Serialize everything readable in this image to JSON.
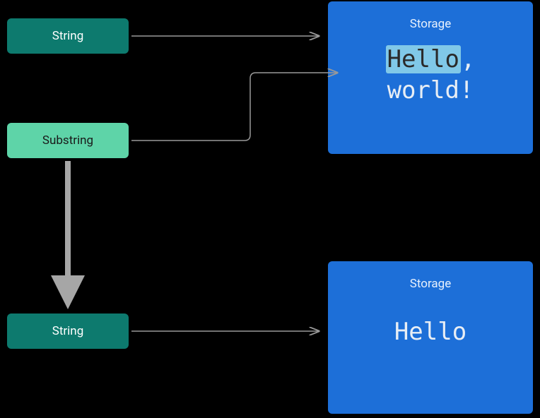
{
  "nodes": {
    "string1": {
      "label": "String"
    },
    "substring": {
      "label": "Substring"
    },
    "string2": {
      "label": "String"
    }
  },
  "storage1": {
    "label": "Storage",
    "highlighted": "Hello",
    "rest_line1": ",",
    "line2": "world!"
  },
  "storage2": {
    "label": "Storage",
    "content": "Hello"
  }
}
